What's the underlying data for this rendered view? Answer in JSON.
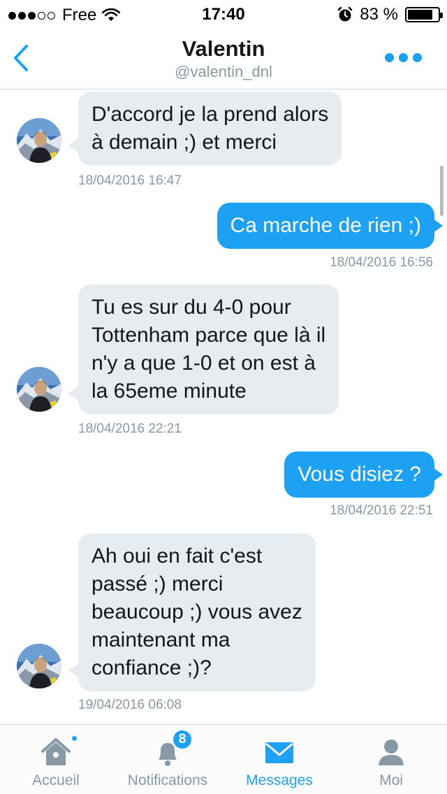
{
  "status_bar": {
    "carrier": "Free",
    "time": "17:40",
    "battery_text": "83 %",
    "battery_level": 0.83,
    "signal_bars_filled": 3,
    "signal_bars_total": 5
  },
  "header": {
    "name": "Valentin",
    "handle": "@valentin_dnl"
  },
  "messages": [
    {
      "direction": "in",
      "text": "D'accord je la prend alors\nà demain ;) et merci",
      "timestamp": "18/04/2016 16:47"
    },
    {
      "direction": "out",
      "text": "Ca marche de rien ;)",
      "timestamp": "18/04/2016 16:56"
    },
    {
      "direction": "in",
      "text": "Tu es sur du 4-0 pour\nTottenham parce que là il\nn'y a que 1-0 et on est à\nla 65eme minute",
      "timestamp": "18/04/2016 22:21"
    },
    {
      "direction": "out",
      "text": "Vous disiez ?",
      "timestamp": "18/04/2016 22:51"
    },
    {
      "direction": "in",
      "text": "Ah oui en fait c'est\npassé ;) merci\nbeaucoup ;) vous avez\nmaintenant ma\nconfiance ;)?",
      "timestamp": "19/04/2016 06:08"
    }
  ],
  "tabbar": {
    "home": {
      "label": "Accueil",
      "icon": "home-icon"
    },
    "notifications": {
      "label": "Notifications",
      "icon": "bell-icon",
      "badge": "8"
    },
    "messages": {
      "label": "Messages",
      "icon": "envelope-icon"
    },
    "me": {
      "label": "Moi",
      "icon": "person-icon"
    }
  },
  "colors": {
    "accent": "#1da1f2",
    "incoming_bubble": "#e6ecf0",
    "muted_text": "#8899a6"
  }
}
